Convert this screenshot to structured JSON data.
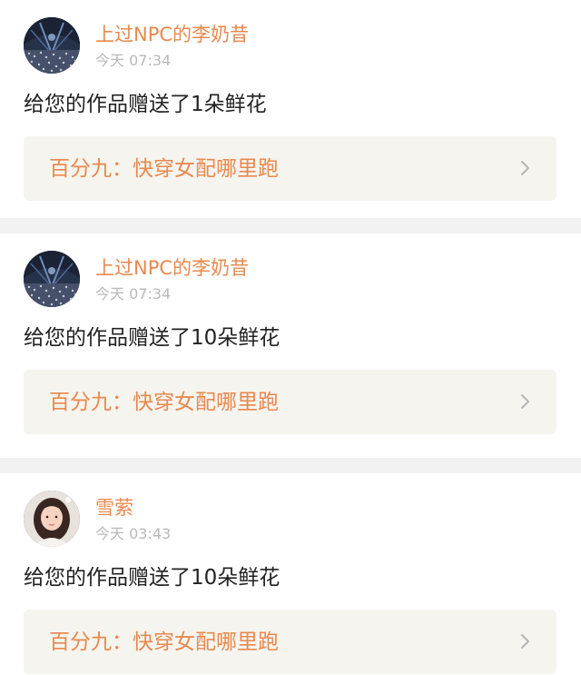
{
  "notifications": [
    {
      "user": "上过NPC的李奶昔",
      "time": "今天 07:34",
      "message": "给您的作品赠送了1朵鲜花",
      "book": "百分九：快穿女配哪里跑",
      "avatar": "concert-crowd-avatar"
    },
    {
      "user": "上过NPC的李奶昔",
      "time": "今天 07:34",
      "message": "给您的作品赠送了10朵鲜花",
      "book": "百分九：快穿女配哪里跑",
      "avatar": "concert-crowd-avatar"
    },
    {
      "user": "雪萦",
      "time": "今天 03:43",
      "message": "给您的作品赠送了10朵鲜花",
      "book": "百分九：快穿女配哪里跑",
      "avatar": "girl-portrait-avatar"
    }
  ],
  "colors": {
    "accent": "#e8894e",
    "muted": "#b9b9b9",
    "card_bg": "#f5f4ef",
    "divider": "#f2f2f2"
  },
  "icons": {
    "chevron": "chevron-right-icon"
  }
}
